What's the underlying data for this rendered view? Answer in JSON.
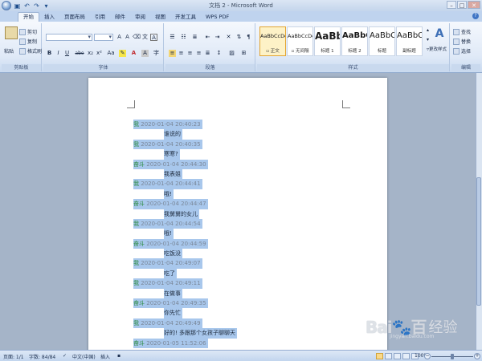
{
  "window": {
    "title": "文档 2 - Microsoft Word",
    "controls": [
      "–",
      "□",
      "✕"
    ]
  },
  "quick_access": {
    "icons": [
      "save-icon",
      "undo-icon",
      "redo-icon",
      "customize-icon"
    ]
  },
  "ribbon_tabs": [
    {
      "label": "开始",
      "active": true
    },
    {
      "label": "插入"
    },
    {
      "label": "页面布局"
    },
    {
      "label": "引用"
    },
    {
      "label": "邮件"
    },
    {
      "label": "审阅"
    },
    {
      "label": "视图"
    },
    {
      "label": "开发工具"
    },
    {
      "label": "WPS PDF"
    }
  ],
  "clipboard": {
    "paste": "粘贴",
    "cut": "剪切",
    "copy": "复制",
    "format_painter": "格式刷",
    "label": "剪贴板"
  },
  "font": {
    "label": "字体",
    "name": "",
    "size": "",
    "buttons": [
      "B",
      "I",
      "U",
      "abe",
      "x₂",
      "x²",
      "Aa",
      "A"
    ]
  },
  "paragraph": {
    "label": "段落"
  },
  "styles": {
    "label": "样式",
    "items": [
      {
        "sample": "AaBbCcDd",
        "name": "▫ 正文",
        "selected": true
      },
      {
        "sample": "AaBbCcDd",
        "name": "▫ 无间隔"
      },
      {
        "sample": "AaBb",
        "name": "标题 1"
      },
      {
        "sample": "AaBbC",
        "name": "标题 2"
      },
      {
        "sample": "AaBbC",
        "name": "标题"
      },
      {
        "sample": "AaBbC",
        "name": "副标题"
      }
    ],
    "change_styles": "更改样式"
  },
  "editing": {
    "label": "编辑",
    "find": "查找",
    "replace": "替换",
    "select": "选择"
  },
  "chat": [
    {
      "type": "header",
      "sender": "我",
      "time": "2020-01-04 20:40:23"
    },
    {
      "type": "message",
      "text": "谁说的"
    },
    {
      "type": "header",
      "sender": "我",
      "time": "2020-01-04 20:40:35"
    },
    {
      "type": "message",
      "text": "寒寒?"
    },
    {
      "type": "header",
      "sender": "奋斗",
      "time": "2020-01-04 20:44:30"
    },
    {
      "type": "message",
      "text": "我表姐"
    },
    {
      "type": "header",
      "sender": "我",
      "time": "2020-01-04 20:44:41"
    },
    {
      "type": "message",
      "text": "哦!"
    },
    {
      "type": "header",
      "sender": "奋斗",
      "time": "2020-01-04 20:44:47"
    },
    {
      "type": "message",
      "text": "我舅舅的女儿"
    },
    {
      "type": "header",
      "sender": "我",
      "time": "2020-01-04 20:44:54"
    },
    {
      "type": "message",
      "text": "哦!"
    },
    {
      "type": "header",
      "sender": "奋斗",
      "time": "2020-01-04 20:44:59"
    },
    {
      "type": "message",
      "text": "吃饭没"
    },
    {
      "type": "header",
      "sender": "我",
      "time": "2020-01-04 20:49:07"
    },
    {
      "type": "message",
      "text": "吃了"
    },
    {
      "type": "header",
      "sender": "我",
      "time": "2020-01-04 20:49:11"
    },
    {
      "type": "message",
      "text": "在做事"
    },
    {
      "type": "header",
      "sender": "奋斗",
      "time": "2020-01-04 20:49:35"
    },
    {
      "type": "message",
      "text": "你先忙"
    },
    {
      "type": "header",
      "sender": "我",
      "time": "2020-01-04 20:49:49"
    },
    {
      "type": "message",
      "text": "好的! 多跟那个女孩子聊聊天"
    },
    {
      "type": "header",
      "sender": "奋斗",
      "time": "2020-01-05 11:52:06"
    }
  ],
  "status": {
    "page": "页面: 1/1",
    "words": "字数: 84/84",
    "language": "中文(中国)",
    "mode": "插入",
    "zoom": "100%",
    "zoom_level": 1.0
  },
  "watermark": {
    "logo": "Bai🐾百",
    "text": "经验",
    "url": "jingyan.baidu.com"
  }
}
